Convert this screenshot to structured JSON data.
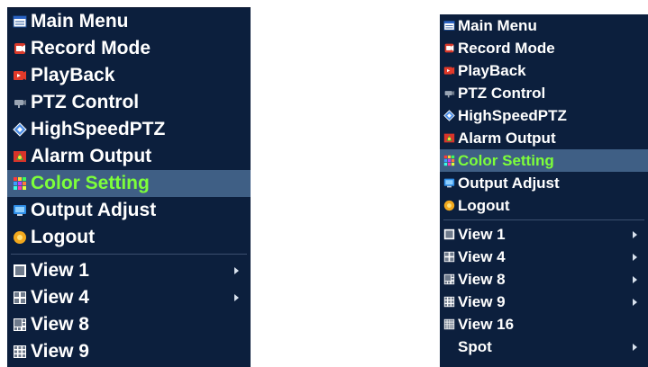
{
  "left_menu": {
    "items": [
      {
        "label": "Main Menu",
        "icon": "main-menu-icon"
      },
      {
        "label": "Record Mode",
        "icon": "record-mode-icon"
      },
      {
        "label": "PlayBack",
        "icon": "playback-icon"
      },
      {
        "label": "PTZ Control",
        "icon": "ptz-control-icon"
      },
      {
        "label": "HighSpeedPTZ",
        "icon": "highspeed-ptz-icon"
      },
      {
        "label": "Alarm Output",
        "icon": "alarm-output-icon"
      },
      {
        "label": "Color Setting",
        "icon": "color-setting-icon",
        "selected": true
      },
      {
        "label": "Output Adjust",
        "icon": "output-adjust-icon"
      },
      {
        "label": "Logout",
        "icon": "logout-icon"
      }
    ],
    "views": [
      {
        "label": "View 1",
        "icon": "view-1-icon",
        "submenu": true
      },
      {
        "label": "View 4",
        "icon": "view-4-icon",
        "submenu": true
      },
      {
        "label": "View 8",
        "icon": "view-8-icon",
        "submenu": false
      },
      {
        "label": "View 9",
        "icon": "view-9-icon",
        "submenu": false
      }
    ]
  },
  "right_menu": {
    "items": [
      {
        "label": "Main Menu",
        "icon": "main-menu-icon"
      },
      {
        "label": "Record Mode",
        "icon": "record-mode-icon"
      },
      {
        "label": "PlayBack",
        "icon": "playback-icon"
      },
      {
        "label": "PTZ Control",
        "icon": "ptz-control-icon"
      },
      {
        "label": "HighSpeedPTZ",
        "icon": "highspeed-ptz-icon"
      },
      {
        "label": "Alarm Output",
        "icon": "alarm-output-icon"
      },
      {
        "label": "Color Setting",
        "icon": "color-setting-icon",
        "selected": true
      },
      {
        "label": "Output Adjust",
        "icon": "output-adjust-icon"
      },
      {
        "label": "Logout",
        "icon": "logout-icon"
      }
    ],
    "views": [
      {
        "label": "View 1",
        "icon": "view-1-icon",
        "submenu": true
      },
      {
        "label": "View 4",
        "icon": "view-4-icon",
        "submenu": true
      },
      {
        "label": "View 8",
        "icon": "view-8-icon",
        "submenu": true
      },
      {
        "label": "View 9",
        "icon": "view-9-icon",
        "submenu": true
      },
      {
        "label": "View 16",
        "icon": "view-16-icon",
        "submenu": false
      },
      {
        "label": "Spot",
        "icon": "",
        "submenu": true
      }
    ]
  },
  "colors": {
    "menu_background": "#0c1f3d",
    "selected_background": "#3f5f85",
    "selected_text": "#7dff3a",
    "text": "#ffffff"
  }
}
